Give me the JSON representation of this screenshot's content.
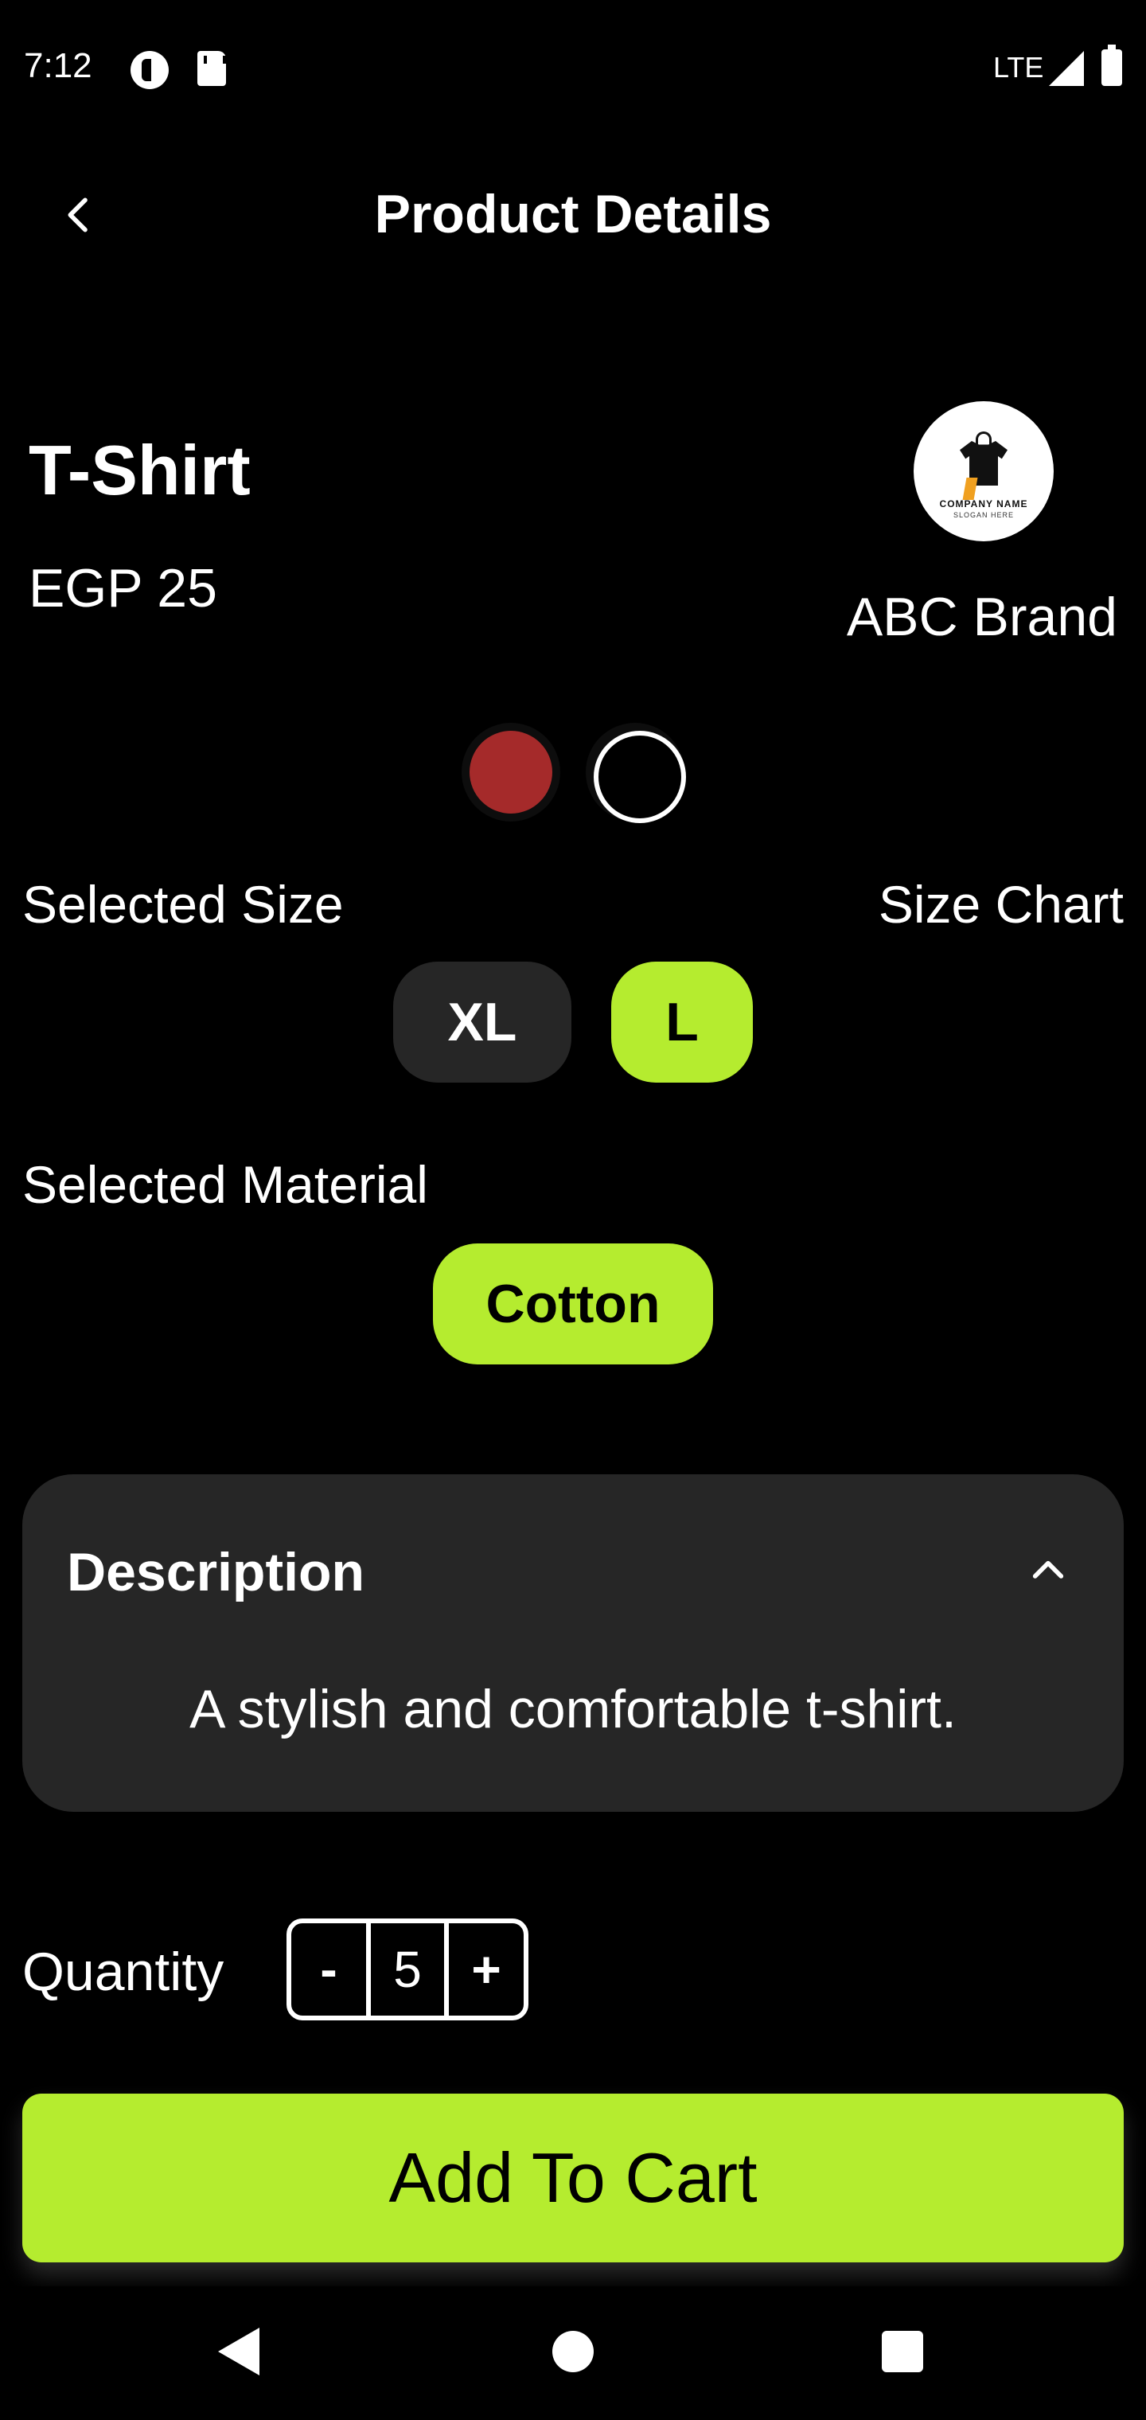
{
  "status_bar": {
    "time": "7:12",
    "network": "LTE",
    "icons": [
      "circle-half-icon",
      "sd-card-icon",
      "signal-icon",
      "battery-icon"
    ]
  },
  "app_bar": {
    "title": "Product Details",
    "back_icon": "chevron-left-icon"
  },
  "product": {
    "name": "T-Shirt",
    "price": "EGP 25",
    "brand": {
      "name": "ABC Brand",
      "logo_company": "COMPANY NAME",
      "logo_slogan": "SLOGAN HERE"
    }
  },
  "colors": [
    {
      "name": "red",
      "hex": "#a52a2a",
      "selected": true
    },
    {
      "name": "white",
      "hex": "#ffffff",
      "selected": false
    }
  ],
  "size": {
    "label": "Selected Size",
    "chart_link": "Size Chart",
    "options": [
      {
        "label": "XL",
        "selected": false
      },
      {
        "label": "L",
        "selected": true
      }
    ]
  },
  "material": {
    "label": "Selected Material",
    "options": [
      {
        "label": "Cotton",
        "selected": true
      }
    ]
  },
  "description": {
    "title": "Description",
    "text": "A stylish and comfortable t-shirt.",
    "expanded": true
  },
  "quantity": {
    "label": "Quantity",
    "minus": "-",
    "value": "5",
    "plus": "+"
  },
  "add_to_cart": {
    "label": "Add To Cart"
  },
  "theme": {
    "accent": "#b5ec2f",
    "surface": "#262626",
    "background": "#000000"
  }
}
